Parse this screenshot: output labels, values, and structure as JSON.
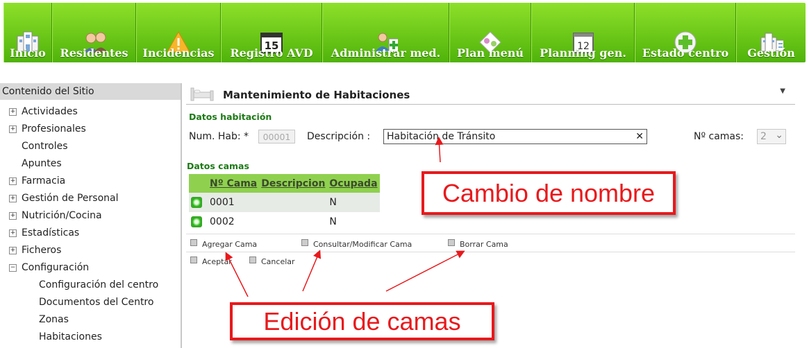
{
  "nav": [
    {
      "label": "Inicio",
      "icon": "building-icon"
    },
    {
      "label": "Residentes",
      "icon": "residents-icon"
    },
    {
      "label": "Incidencias",
      "icon": "warning-icon"
    },
    {
      "label": "Registro AVD",
      "icon": "calendar-15-icon"
    },
    {
      "label": "Administrar med.",
      "icon": "medication-icon"
    },
    {
      "label": "Plan menú",
      "icon": "menu-plan-icon"
    },
    {
      "label": "Planning gen.",
      "icon": "calendar-12-icon"
    },
    {
      "label": "Estado centro",
      "icon": "health-cross-icon"
    },
    {
      "label": "Gestión",
      "icon": "management-icon"
    }
  ],
  "sidebar": {
    "title": "Contenido del Sitio",
    "items": [
      {
        "label": "Actividades",
        "toggle": "+"
      },
      {
        "label": "Profesionales",
        "toggle": "+"
      },
      {
        "label": "Controles",
        "toggle": ""
      },
      {
        "label": "Apuntes",
        "toggle": ""
      },
      {
        "label": "Farmacia",
        "toggle": "+"
      },
      {
        "label": "Gestión de Personal",
        "toggle": "+"
      },
      {
        "label": "Nutrición/Cocina",
        "toggle": "+"
      },
      {
        "label": "Estadísticas",
        "toggle": "+"
      },
      {
        "label": "Ficheros",
        "toggle": "+"
      },
      {
        "label": "Configuración",
        "toggle": "−"
      }
    ],
    "subitems": [
      "Configuración del centro",
      "Documentos del Centro",
      "Zonas",
      "Habitaciones"
    ]
  },
  "main": {
    "title": "Mantenimiento de Habitaciones",
    "section_room": "Datos habitación",
    "num_hab_label": "Num. Hab: *",
    "num_hab_value": "00001",
    "desc_label": "Descripción :",
    "desc_value": "Habitación de Tránsito",
    "clear_glyph": "✕",
    "camas_label": "Nº camas:",
    "camas_value": "2",
    "section_beds": "Datos camas",
    "columns": [
      "Nº Cama",
      "Descripcion",
      "Ocupada"
    ],
    "rows": [
      {
        "num": "0001",
        "desc": "",
        "occ": "N"
      },
      {
        "num": "0002",
        "desc": "",
        "occ": "N"
      }
    ],
    "actions": [
      "Agregar Cama",
      "Consultar/Modificar Cama",
      "Borrar Cama"
    ],
    "accept": "Aceptar",
    "cancel": "Cancelar"
  },
  "annotations": {
    "rename": "Cambio de nombre",
    "beds_edit": "Edición de camas",
    "color": "#e8191c"
  }
}
